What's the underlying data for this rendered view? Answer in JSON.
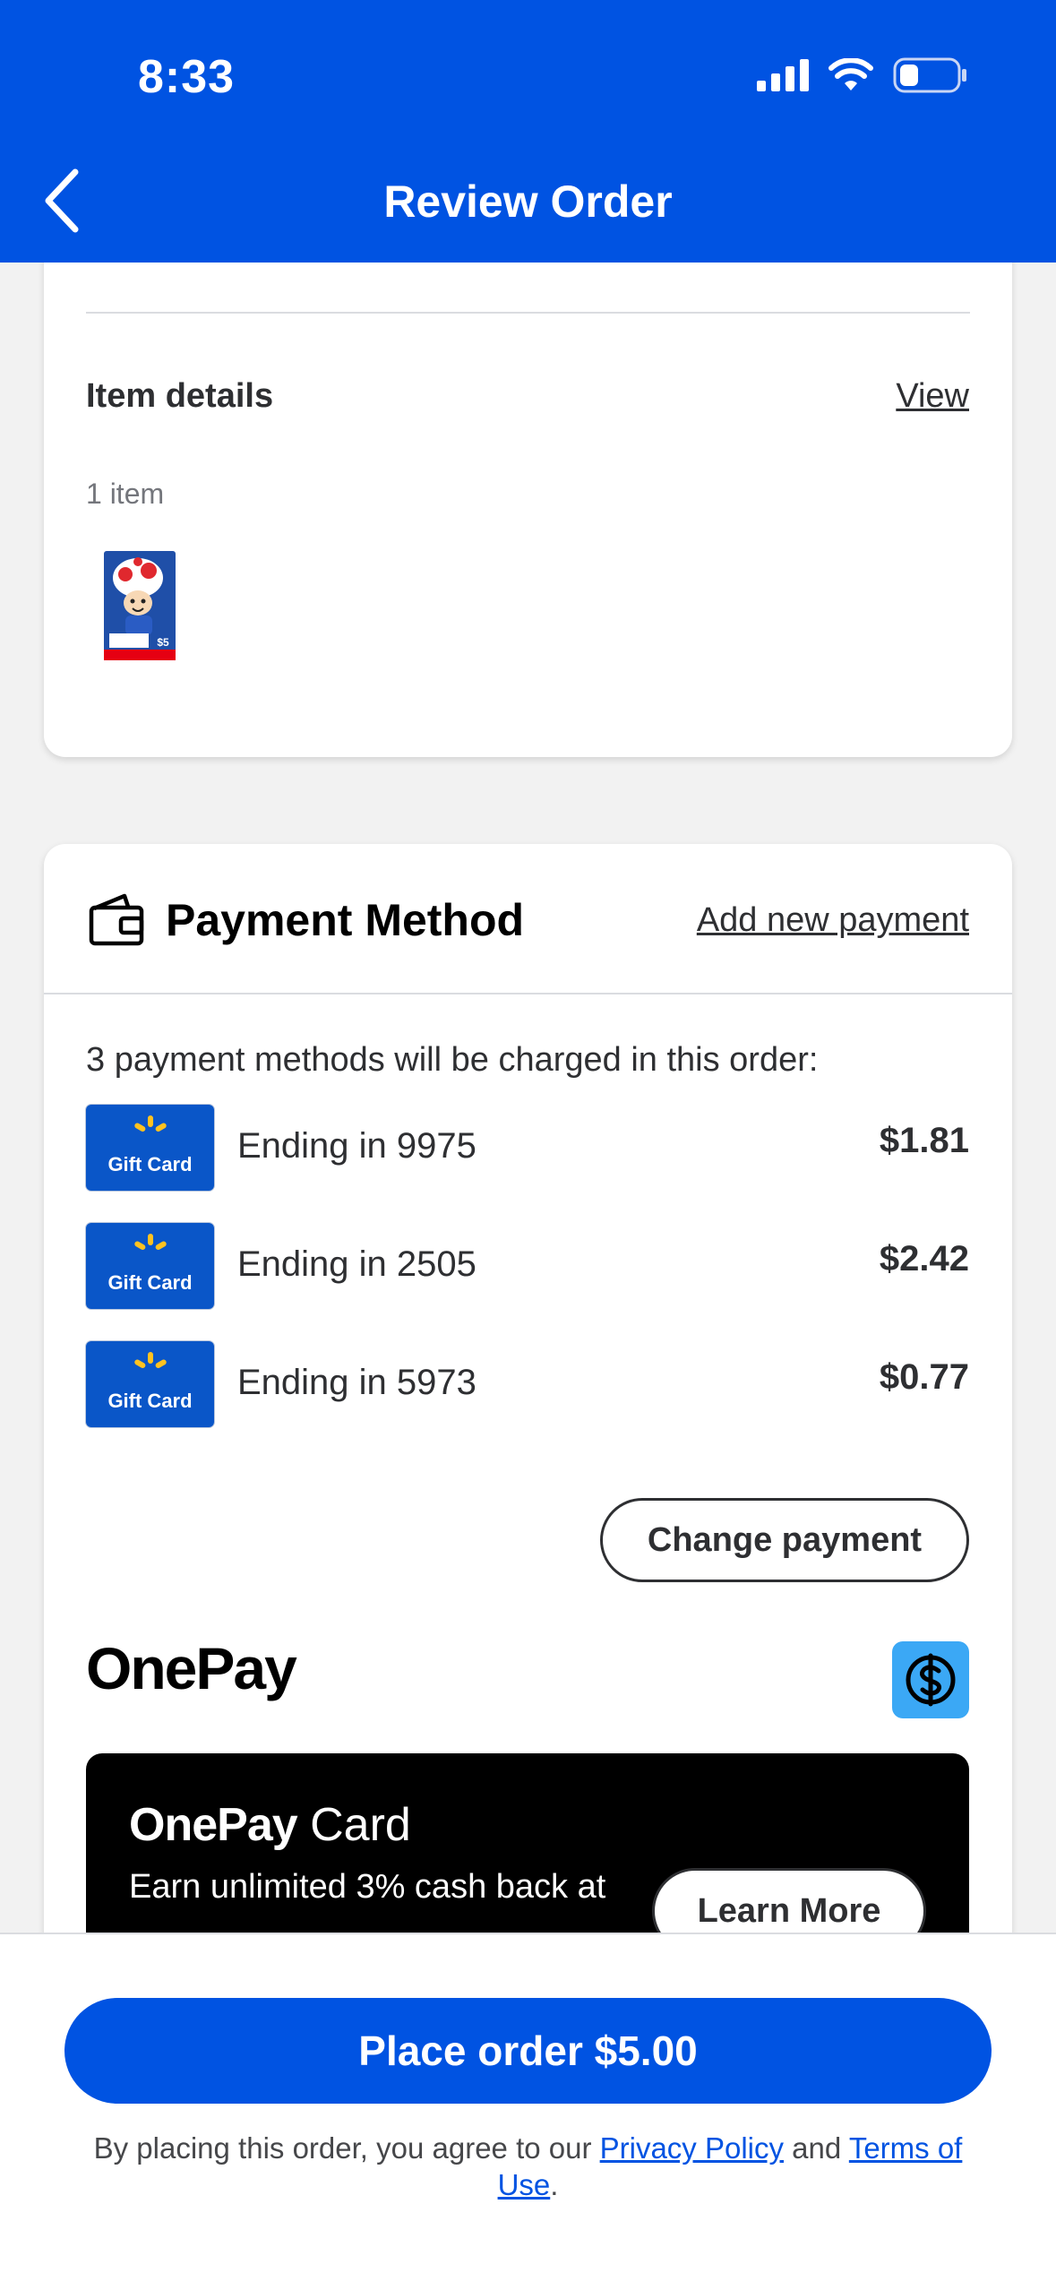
{
  "status_bar": {
    "time": "8:33",
    "icons": [
      "cellular-signal-icon",
      "wifi-icon",
      "battery-icon"
    ]
  },
  "header": {
    "title": "Review Order",
    "back_icon": "chevron-left-icon",
    "background": "#0053e2"
  },
  "items_card": {
    "heading": "Item details",
    "view_link": "View",
    "count": "1 item",
    "thumbnail": "nintendo-eshop-gift-card-thumbnail"
  },
  "payment": {
    "icon": "wallet-icon",
    "title": "Payment Method",
    "add_link": "Add new payment",
    "summary": "3 payment methods will be charged in this order:",
    "methods": [
      {
        "card_label": "Gift Card",
        "ending": "Ending in 9975",
        "amount": "$1.81"
      },
      {
        "card_label": "Gift Card",
        "ending": "Ending in 2505",
        "amount": "$2.42"
      },
      {
        "card_label": "Gift Card",
        "ending": "Ending in 5973",
        "amount": "$0.77"
      }
    ],
    "change_button": "Change payment"
  },
  "onepay": {
    "logo": "OnePay",
    "badge_icon": "onepay-dollar-icon",
    "promo": {
      "title_brand": "OnePay",
      "title_suffix": " Card",
      "text": "Earn unlimited 3% cash back at",
      "button": "Learn More"
    }
  },
  "footer": {
    "place_order": "Place order $5.00",
    "legal_prefix": "By placing this order, you agree to our ",
    "privacy_link": "Privacy Policy",
    "legal_mid": " and ",
    "terms_link": "Terms of Use",
    "legal_suffix": "."
  },
  "colors": {
    "brand_blue": "#0053e2",
    "gift_card_blue": "#0a56c8",
    "spark_yellow": "#ffc220",
    "onepay_badge": "#3ba8f5"
  }
}
